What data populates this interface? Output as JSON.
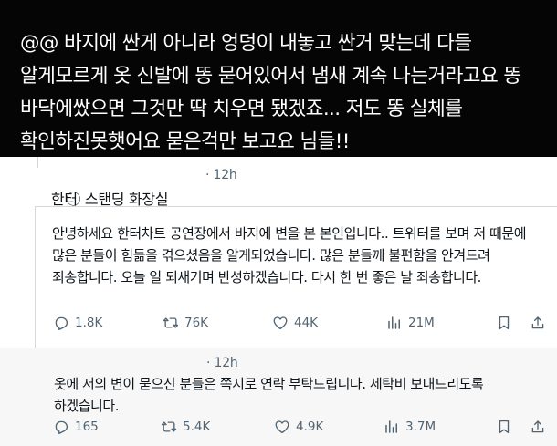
{
  "caption": {
    "text": "@@ 바지에 싼게 아니라 엉덩이 내놓고 싼거 맞는데 다들 알게모르게 옷 신발에 똥 묻어있어서 냄새 계속 나는거라고요 똥 바닥에쌌으면 그것만 딱 치우면 됐겠죠... 저도 똥 실체를 확인하진못햇어요 묻은걱만 보고요 님들!!"
  },
  "tweets": [
    {
      "time": "· 12h",
      "author": "한터 ⃝ 스탠딩 화장실",
      "text": "안녕하세요 한터차트 공연장에서 바지에 변을 본 본인입니다.. 트위터를 보며 저 때문에 많은 분들이 힘듦을 겪으셨음을 알게되었습니다. 많은 분들께 불편함을 안겨드려 죄송합니다. 오늘 일 되새기며 반성하겠습니다. 다시 한 번 좋은 날 죄송합니다.",
      "stats": {
        "replies": "1.8K",
        "retweets": "76K",
        "likes": "44K",
        "views": "21M"
      }
    },
    {
      "time": "· 12h",
      "text": "옷에 저의 변이 묻으신 분들은 쪽지로 연락 부탁드립니다. 세탁비 보내드리도록 하겠습니다.",
      "stats": {
        "replies": "165",
        "retweets": "5.4K",
        "likes": "4.9K",
        "views": "3.7M"
      }
    }
  ],
  "icons": [
    "reply-icon",
    "retweet-icon",
    "like-icon",
    "views-icon",
    "bookmark-icon",
    "share-icon"
  ],
  "colors": {
    "caption_bg": "#050505",
    "caption_text": "#ffffff",
    "meta_gray": "#536471",
    "text": "#0f1419"
  }
}
